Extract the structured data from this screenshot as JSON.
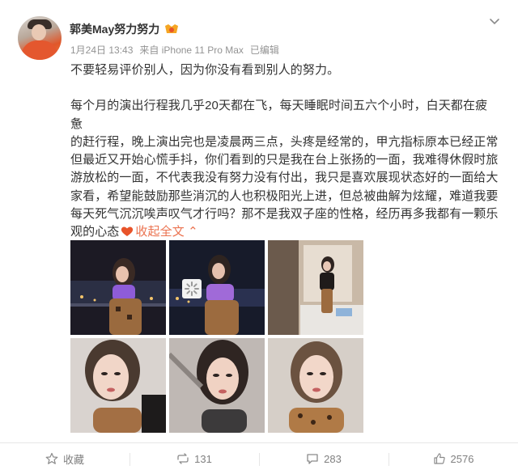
{
  "post": {
    "author": "郭美May努力努力",
    "date": "1月24日 13:43",
    "source": "来自 iPhone 11 Pro Max",
    "edited": "已编辑",
    "intro": "不要轻易评价别人，因为你没有看到别人的努力。",
    "body_lines": [
      "每个月的演出行程我几乎20天都在飞，每天睡眠时间五六个小时，白天都在疲惫",
      "的赶行程，晚上演出完也是凌晨两三点，头疼是经常的，甲亢指标原本已经正常",
      "但最近又开始心慌手抖，你们看到的只是我在台上张扬的一面，我难得休假时旅",
      "游放松的一面，不代表我没有努力没有付出，我只是喜欢展现状态好的一面给大",
      "家看，希望能鼓励那些消沉的人也积极阳光上进，但总被曲解为炫耀，难道我要",
      "每天死气沉沉唉声叹气才行吗？那不是我双子座的性格，经历再多我都有一颗乐"
    ],
    "last_line": "观的心态",
    "collapse_label": "收起全文",
    "collapse_arrow": "⌃"
  },
  "actions": {
    "favorite": "收藏",
    "repost": "131",
    "comment": "283",
    "like": "2576"
  },
  "colors": {
    "accent": "#eb7350",
    "text": "#333333",
    "meta": "#939393",
    "heart": "#e8542a"
  }
}
